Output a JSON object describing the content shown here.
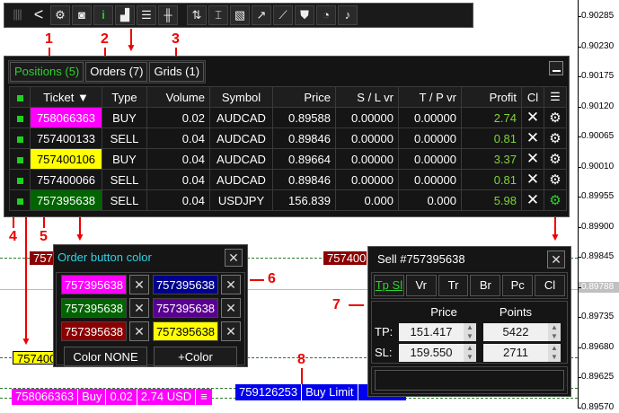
{
  "price_axis": [
    "0.90285",
    "0.90230",
    "0.90175",
    "0.90120",
    "0.90065",
    "0.90010",
    "0.89955",
    "0.89900",
    "0.89845",
    "0.89788",
    "0.89735",
    "0.89680",
    "0.89625",
    "0.89570"
  ],
  "toolbar": {
    "icons": [
      "grip-icon",
      "back-icon",
      "gear-icon",
      "camera-icon",
      "info-icon",
      "signal-icon",
      "list-icon",
      "candles-icon",
      "sort-icon",
      "chain-icon",
      "document-icon",
      "trend-up-icon",
      "trend-line-icon",
      "shield-icon",
      "pie-icon",
      "bell-icon"
    ],
    "info_label": "i",
    "back_label": "<"
  },
  "annotations": [
    "1",
    "2",
    "3",
    "4",
    "5",
    "6",
    "7",
    "8"
  ],
  "tabs": [
    {
      "label": "Positions (5)"
    },
    {
      "label": "Orders (7)"
    },
    {
      "label": "Grids (1)"
    }
  ],
  "table": {
    "headers": [
      "Ticket ▼",
      "Type",
      "Volume",
      "Symbol",
      "Price",
      "S / L vr",
      "T / P vr",
      "Profit",
      "Cl"
    ],
    "rows": [
      {
        "ticket": "758066363",
        "type": "BUY",
        "volume": "0.02",
        "symbol": "AUDCAD",
        "price": "0.89588",
        "sl": "0.00000",
        "tp": "0.00000",
        "profit": "2.74",
        "bg": "#ff00ff",
        "fg": "#fff"
      },
      {
        "ticket": "757400133",
        "type": "SELL",
        "volume": "0.04",
        "symbol": "AUDCAD",
        "price": "0.89846",
        "sl": "0.00000",
        "tp": "0.00000",
        "profit": "0.81",
        "bg": "#151515",
        "fg": "#fff"
      },
      {
        "ticket": "757400106",
        "type": "BUY",
        "volume": "0.04",
        "symbol": "AUDCAD",
        "price": "0.89664",
        "sl": "0.00000",
        "tp": "0.00000",
        "profit": "3.37",
        "bg": "#ffff00",
        "fg": "#000"
      },
      {
        "ticket": "757400066",
        "type": "SELL",
        "volume": "0.04",
        "symbol": "AUDCAD",
        "price": "0.89846",
        "sl": "0.00000",
        "tp": "0.00000",
        "profit": "0.81",
        "bg": "#151515",
        "fg": "#fff"
      },
      {
        "ticket": "757395638",
        "type": "SELL",
        "volume": "0.04",
        "symbol": "USDJPY",
        "price": "156.839",
        "sl": "0.000",
        "tp": "0.000",
        "profit": "5.98",
        "bg": "#006400",
        "fg": "#fff"
      }
    ]
  },
  "color_dialog": {
    "title": "Order button color",
    "swatches": [
      {
        "label": "757395638",
        "bg": "#ff00ff",
        "fg": "#fff"
      },
      {
        "label": "757395638",
        "bg": "#00008b",
        "fg": "#fff"
      },
      {
        "label": "757395638",
        "bg": "#006400",
        "fg": "#fff"
      },
      {
        "label": "757395638",
        "bg": "#5a0090",
        "fg": "#fff"
      },
      {
        "label": "757395638",
        "bg": "#8b0000",
        "fg": "#fff"
      },
      {
        "label": "757395638",
        "bg": "#ffff00",
        "fg": "#000"
      }
    ],
    "none_label": "Color NONE",
    "add_label": "+Color"
  },
  "order_dialog": {
    "title": "Sell  #757395638",
    "tabs": [
      "Tp Sl",
      "Vr",
      "Tr",
      "Br",
      "Pc",
      "Cl"
    ],
    "price_header": "Price",
    "points_header": "Points",
    "tp_label": "TP:",
    "sl_label": "SL:",
    "tp_price": "151.417",
    "tp_points": "5422",
    "sl_price": "159.550",
    "sl_points": "2711"
  },
  "chart_labels": {
    "red1": "757",
    "red2": "757400",
    "yellow": "757400",
    "position_line": [
      "758066363",
      "Buy",
      "0.02",
      "2.74 USD",
      "≡"
    ],
    "buy_limit": [
      "759126253",
      "Buy Limit"
    ]
  }
}
